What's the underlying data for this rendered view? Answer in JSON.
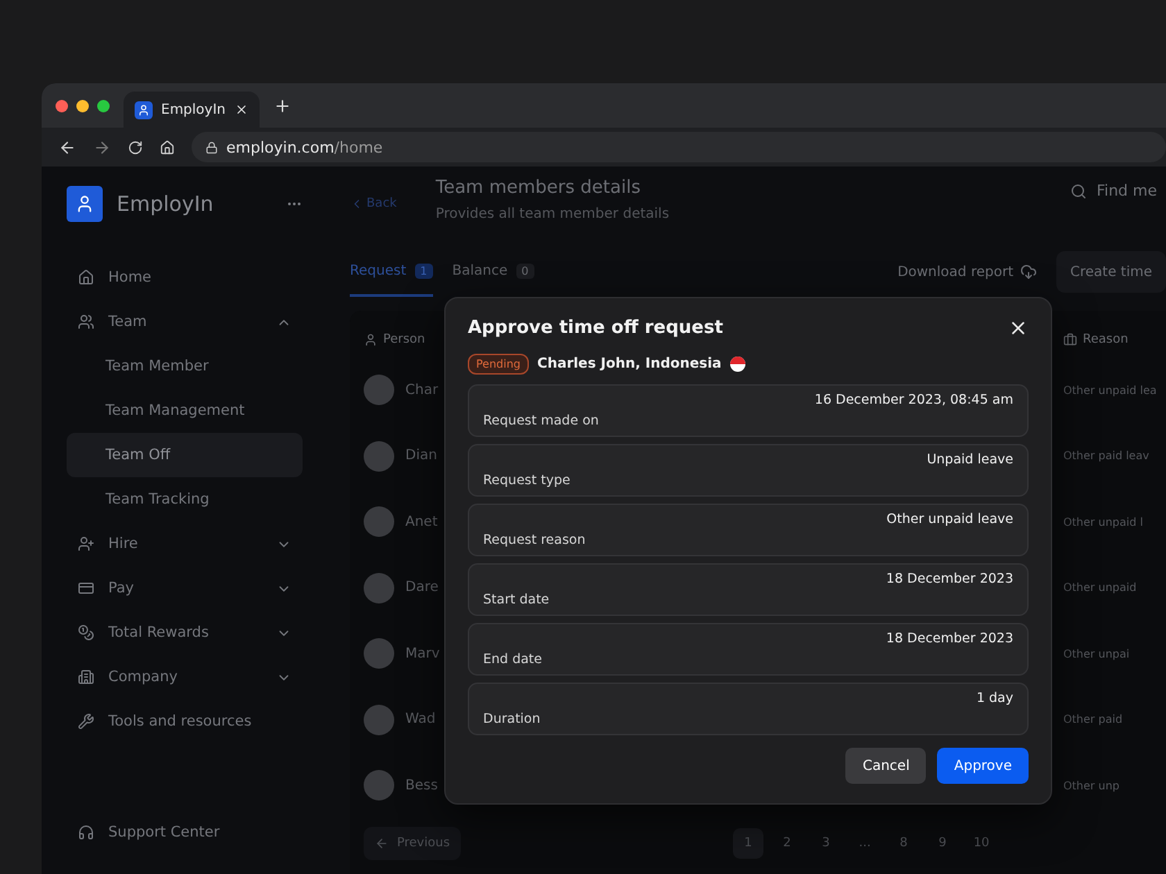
{
  "browser": {
    "tab_title": "EmployIn",
    "url_host": "employin.com",
    "url_path": "/home"
  },
  "sidebar": {
    "brand": "EmployIn",
    "items": [
      {
        "label": "Home",
        "selected": false,
        "has_chevron": false
      },
      {
        "label": "Team",
        "expanded": true,
        "selected": false,
        "has_chevron": true,
        "children": [
          {
            "label": "Team Member",
            "selected": false
          },
          {
            "label": "Team Management",
            "selected": false
          },
          {
            "label": "Team Off",
            "selected": true
          },
          {
            "label": "Team Tracking",
            "selected": false
          }
        ]
      },
      {
        "label": "Hire",
        "expanded": false,
        "selected": false,
        "has_chevron": true
      },
      {
        "label": "Pay",
        "expanded": false,
        "selected": false,
        "has_chevron": true
      },
      {
        "label": "Total Rewards",
        "expanded": false,
        "selected": false,
        "has_chevron": true
      },
      {
        "label": "Company",
        "expanded": false,
        "selected": false,
        "has_chevron": true
      },
      {
        "label": "Tools and resources",
        "selected": false,
        "has_chevron": false
      }
    ],
    "footer": "Support Center"
  },
  "header": {
    "back": "Back",
    "title": "Team members details",
    "subtitle": "Provides all team member details",
    "search_placeholder": "Find me"
  },
  "actions": {
    "download": "Download report",
    "create": "Create time"
  },
  "tabs": [
    {
      "label": "Request",
      "count": "1",
      "selected": true
    },
    {
      "label": "Balance",
      "count": "0",
      "selected": false
    }
  ],
  "table": {
    "columns": [
      "Person",
      "Reason"
    ],
    "rows": [
      {
        "person": "Char",
        "reason": "Other unpaid lea"
      },
      {
        "person": "Dian",
        "reason": "Other paid leav"
      },
      {
        "person": "Anet",
        "reason": "Other unpaid l"
      },
      {
        "person": "Dare",
        "reason": "Other unpaid"
      },
      {
        "person": "Marv",
        "reason": "Other unpai"
      },
      {
        "person": "Wad",
        "reason": "Other paid"
      },
      {
        "person": "Bess",
        "reason": "Other unp"
      }
    ]
  },
  "pagination": {
    "previous": "Previous",
    "pages": [
      {
        "label": "1",
        "selected": true
      },
      {
        "label": "2",
        "selected": false
      },
      {
        "label": "3",
        "selected": false
      },
      {
        "label": "...",
        "selected": false
      },
      {
        "label": "8",
        "selected": false
      },
      {
        "label": "9",
        "selected": false
      },
      {
        "label": "10",
        "selected": false
      }
    ]
  },
  "modal": {
    "title": "Approve time off request",
    "status": "Pending",
    "person": "Charles John, Indonesia",
    "fields": [
      {
        "label": "Request made on",
        "value": "16 December 2023, 08:45 am"
      },
      {
        "label": "Request type",
        "value": "Unpaid leave"
      },
      {
        "label": "Request reason",
        "value": "Other unpaid leave"
      },
      {
        "label": "Start date",
        "value": "18 December 2023"
      },
      {
        "label": "End date",
        "value": "18 December 2023"
      },
      {
        "label": "Duration",
        "value": "1 day"
      }
    ],
    "buttons": [
      {
        "label": "Cancel",
        "kind": "secondary"
      },
      {
        "label": "Approve",
        "kind": "primary"
      }
    ]
  }
}
